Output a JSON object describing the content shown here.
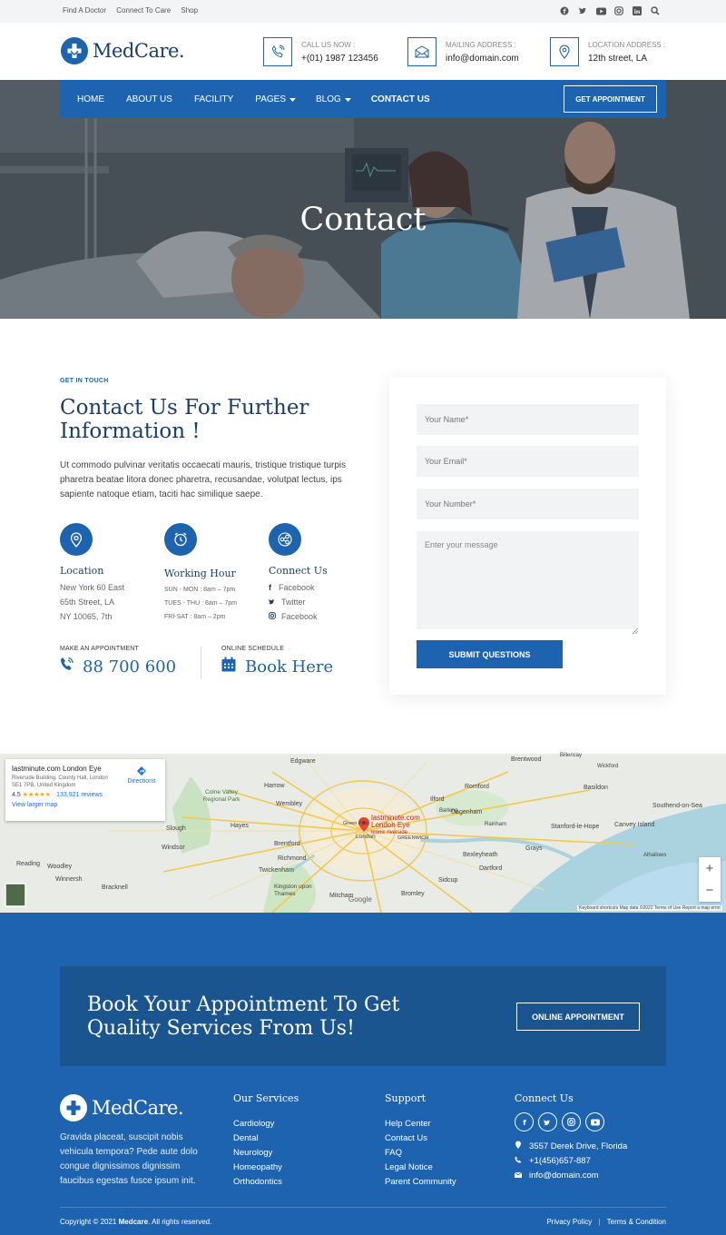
{
  "topbar": {
    "links": [
      "Find A Doctor",
      "Connect To Care",
      "Shop"
    ],
    "social_icons": [
      "facebook-icon",
      "twitter-icon",
      "youtube-icon",
      "instagram-icon",
      "linkedin-icon",
      "search-icon"
    ]
  },
  "header": {
    "logo_text": "MedCare.",
    "call": {
      "label": "CALL US NOW :",
      "value": "+(01) 1987 123456"
    },
    "mail": {
      "label": "MAILING ADDRESS :",
      "value": "info@domain.com"
    },
    "location": {
      "label": "LOCATION ADDRESS :",
      "value": "12th street, LA"
    }
  },
  "nav": {
    "items": [
      "HOME",
      "ABOUT US",
      "FACILITY",
      "PAGES",
      "BLOG",
      "CONTACT US"
    ],
    "appointment_button": "GET APPOINTMENT"
  },
  "hero": {
    "title": "Contact"
  },
  "contact": {
    "eyebrow": "GET IN TOUCH",
    "heading": "Contact Us For Further Information !",
    "paragraph": "Ut commodo pulvinar veritatis occaecati mauris, tristique tristique turpis pharetra beatae litora donec pharetra, recusandae, volutpat lectus, ips sapiente natoque etiam, taciti hac similique saepe.",
    "location": {
      "title": "Location",
      "lines": [
        "New York 60 East",
        "65th Street, LA",
        "NY 10065, 7th"
      ]
    },
    "hours": {
      "title": "Working Hour",
      "lines": [
        "SUN - MON : 8am – 7pm",
        "TUES - THU : 8am – 7pm",
        "FRI-SAT : 8am – 2pm"
      ]
    },
    "connect": {
      "title": "Connect Us",
      "links": [
        "Facebook",
        "Twitter",
        "Facebook"
      ]
    },
    "appointment": {
      "label": "MAKE AN APPOINTMENT",
      "phone": "88 700 600"
    },
    "schedule": {
      "label": "ONLINE SCHEDULE",
      "text": "Book Here"
    }
  },
  "form": {
    "name_placeholder": "Your Name*",
    "email_placeholder": "Your Email*",
    "number_placeholder": "Your Number*",
    "message_placeholder": "Enter your message",
    "submit_label": "SUBMIT QUESTIONS"
  },
  "map": {
    "place_title": "lastminute.com London Eye",
    "address": "Riverside Building, County Hall, London SE1 7PB, United Kingdom",
    "rating": "4.5",
    "stars": "★★★★★",
    "reviews": "133,921 reviews",
    "larger_map": "View larger map",
    "directions": "Directions",
    "pin_label": "lastminute.com London Eye",
    "pin_sub": "Iconic riverside",
    "places": [
      "Brentwood",
      "Edgware",
      "Harrow",
      "Romford",
      "Basildon",
      "Southend-on-Sea",
      "Colne Valley Regional Park",
      "Wembley",
      "Ilford",
      "Dagenham",
      "Slough",
      "Hayes",
      "Brentford",
      "Stanford-le-Hope",
      "Canvey Island",
      "Windsor",
      "Richmond",
      "Twickenham",
      "Bexleyheath",
      "Grays",
      "Reading",
      "Woodley",
      "Winnersh",
      "Bracknell",
      "Kingston upon Thames",
      "Mitcham",
      "Sidcup",
      "Dartford",
      "Bromley",
      "Billericay",
      "Wickford",
      "Rainham",
      "Alhallows",
      "London",
      "Barking",
      "Green Park",
      "GREENWICH"
    ],
    "zoom_in": "+",
    "zoom_out": "−",
    "google": "Google",
    "terms": "Keyboard shortcuts   Map data ©2022   Terms of Use   Report a map error"
  },
  "cta": {
    "title": "Book Your Appointment To Get Quality Services From Us!",
    "button": "ONLINE APPOINTMENT"
  },
  "footer": {
    "logo_text": "MedCare.",
    "text": "Gravida placeat, suscipit nobis vehicula tempora? Pede aute dolo congue dignissimos dignissim faucibus egestas fusce ipsum init.",
    "services": {
      "title": "Our Services",
      "items": [
        "Cardiology",
        "Dental",
        "Neurology",
        "Homeopathy",
        "Orthodontics"
      ]
    },
    "support": {
      "title": "Support",
      "items": [
        "Help Center",
        "Contact Us",
        "FAQ",
        "Legal Notice",
        "Parent Community"
      ]
    },
    "connect": {
      "title": "Connect Us",
      "address": "3557 Derek Drive, Florida",
      "phone": "+1(456)657-887",
      "email": "info@domain.com"
    },
    "copyright_prefix": "Copyright © 2021 ",
    "copyright_brand": "Medcare",
    "copyright_suffix": ". All rights reserved.",
    "privacy": "Privacy Policy",
    "terms": "Terms & Condition"
  },
  "colors": {
    "primary": "#1e63b0",
    "dark_blue": "#1b3f6a",
    "cta_bg": "#1a5590"
  }
}
